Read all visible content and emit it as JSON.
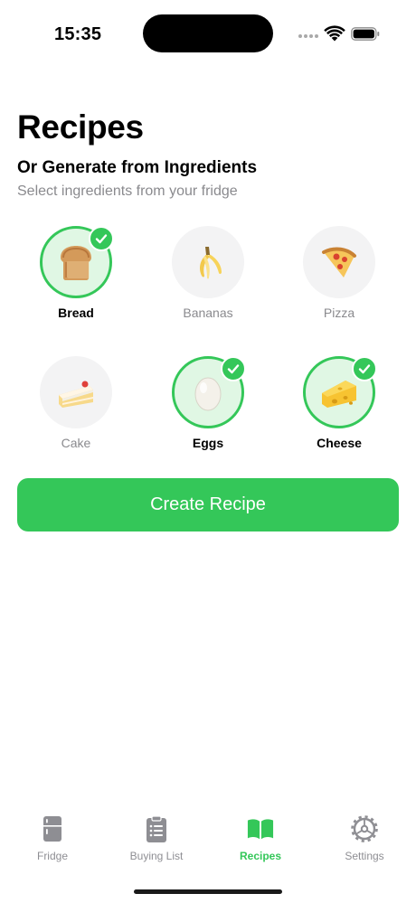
{
  "status_bar": {
    "time": "15:35"
  },
  "header": {
    "title": "Recipes",
    "section_title": "Or Generate from Ingredients",
    "section_subtitle": "Select ingredients from your fridge"
  },
  "ingredients": [
    {
      "label": "Bread",
      "icon": "bread-icon",
      "selected": true
    },
    {
      "label": "Bananas",
      "icon": "banana-icon",
      "selected": false
    },
    {
      "label": "Pizza",
      "icon": "pizza-icon",
      "selected": false
    },
    {
      "label": "Cake",
      "icon": "cake-icon",
      "selected": false
    },
    {
      "label": "Eggs",
      "icon": "egg-icon",
      "selected": true
    },
    {
      "label": "Cheese",
      "icon": "cheese-icon",
      "selected": true
    }
  ],
  "create_button": {
    "label": "Create Recipe"
  },
  "tab_bar": {
    "tabs": [
      {
        "label": "Fridge",
        "icon": "fridge-icon",
        "active": false
      },
      {
        "label": "Buying List",
        "icon": "clipboard-list-icon",
        "active": false
      },
      {
        "label": "Recipes",
        "icon": "book-icon",
        "active": true
      },
      {
        "label": "Settings",
        "icon": "gear-icon",
        "active": false
      }
    ]
  },
  "colors": {
    "accent": "#34c759",
    "selected_bg": "#e0f7e4",
    "unselected_bg": "#f3f3f4",
    "muted_text": "#8a8a8e"
  }
}
